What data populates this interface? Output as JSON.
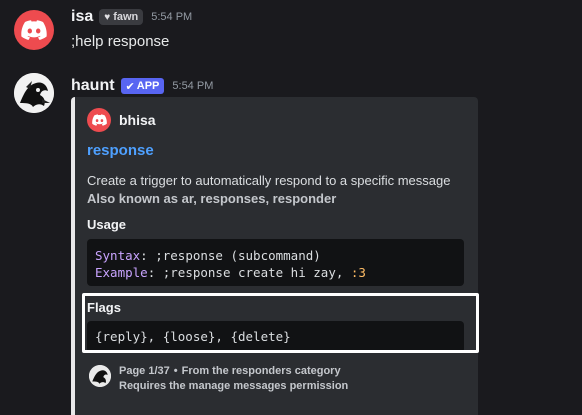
{
  "messages": [
    {
      "username": "isa",
      "tag": "fawn",
      "tag_icon": "heart-icon",
      "time": "5:54 PM",
      "content": ";help response"
    },
    {
      "username": "haunt",
      "app_badge": "APP",
      "time": "5:54 PM",
      "embed": {
        "author": "bhisa",
        "title": "response",
        "description": "Create a trigger to automatically respond to a specific message",
        "aliases": "Also known as ar, responses, responder",
        "usage_label": "Usage",
        "syntax_key": "Syntax",
        "syntax_value": ";response (subcommand)",
        "example_key": "Example",
        "example_value": ";response create hi zay, ",
        "example_emote": ":3",
        "flags_label": "Flags",
        "flags_value": "{reply}, {loose}, {delete}",
        "footer_page": "Page 1/37",
        "footer_bullet": "•",
        "footer_category": "From the responders category",
        "footer_permission": "Requires the manage messages permission",
        "accent_color": "#e9e9ea"
      }
    }
  ],
  "colors": {
    "background": "#1a1a1e",
    "embed_bg": "#2b2d31",
    "link": "#4ea0ff",
    "app_badge": "#5865f2",
    "discord_red": "#ee4b4f"
  }
}
